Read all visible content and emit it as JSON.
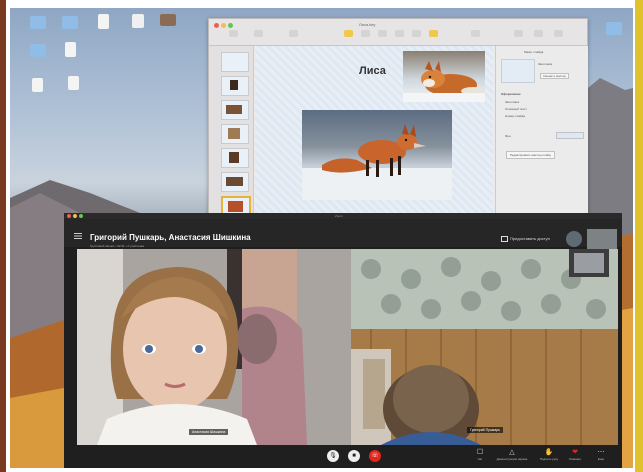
{
  "keynote": {
    "window_title": "Лиса.key",
    "toolbar": [
      "Вид",
      "Масштаб",
      "Добавить",
      "Таблица",
      "Диаграмма",
      "Текст",
      "Фигура",
      "Медиа",
      "Комментарий",
      "Поделиться",
      "Формат",
      "Анимация",
      "Документ"
    ],
    "slide_title": "Лиса",
    "slides": [
      "1",
      "2",
      "3",
      "4",
      "5",
      "6",
      "7"
    ],
    "inspector": {
      "tab": "Макет слайда",
      "layout_name": "Заголовок",
      "change_master": "Сменить мастер",
      "appearance_heading": "Оформление",
      "options": [
        "Заголовок",
        "Основной текст",
        "Номер слайда"
      ],
      "background_label": "Фон",
      "edit_master": "Редактировать мастер-слайд"
    }
  },
  "zoom": {
    "window_title": "Zoom",
    "call_title": "Григорий Пушкарь, Анастасия Шишкина",
    "call_subtitle": "Групповой звонок • 02:31 • 2 участника",
    "share_label": "Предоставить доступ",
    "participants": [
      {
        "name": "Анастасия Шишкина"
      },
      {
        "name": "Григорий Пушкарь"
      }
    ],
    "controls": {
      "chat": "Чат",
      "share_screen": "Демонстрация экрана",
      "raise_hand": "Поднять руку",
      "reactions": "Реакции",
      "more": "Ещё"
    }
  },
  "colors": {
    "end_call": "#e1251b",
    "accent": "#e7b43a",
    "zoom_bg": "#1f1f1f"
  }
}
